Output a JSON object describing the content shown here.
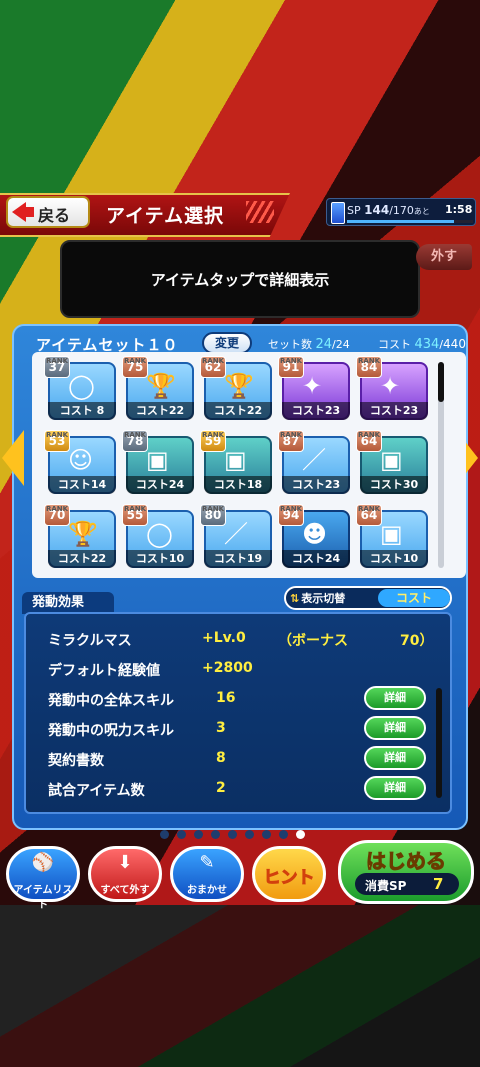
{
  "header": {
    "back_label": "戻る",
    "title": "アイテム選択",
    "sp_label": "SP",
    "sp_current": "144",
    "sp_max": "170",
    "sp_suffix": "あと",
    "timer": "1:58",
    "sp_fill_ratio": 0.847
  },
  "detail": {
    "hint": "アイテムタップで詳細表示",
    "remove_button": "外す"
  },
  "set": {
    "name": "アイテムセット１０",
    "change_button": "変更",
    "count_label": "セット数",
    "count_value": "24",
    "count_max": "24",
    "cost_label": "コスト",
    "cost_value": "434",
    "cost_max": "440"
  },
  "items": [
    {
      "rank_cap": "RANK",
      "rank": "37",
      "rank_color": "silver",
      "cost": "コスト 8",
      "art": "◯",
      "face": "blue"
    },
    {
      "rank_cap": "RANK",
      "rank": "75",
      "rank_color": "bronze",
      "cost": "コスト22",
      "art": "🏆",
      "face": "blue"
    },
    {
      "rank_cap": "RANK",
      "rank": "62",
      "rank_color": "bronze",
      "cost": "コスト22",
      "art": "🏆",
      "face": "blue"
    },
    {
      "rank_cap": "RANK",
      "rank": "91",
      "rank_color": "bronze",
      "cost": "コスト23",
      "art": "✦",
      "face": "purple"
    },
    {
      "rank_cap": "RANK",
      "rank": "84",
      "rank_color": "bronze",
      "cost": "コスト23",
      "art": "✦",
      "face": "purple"
    },
    {
      "rank_cap": "RANK",
      "rank": "53",
      "rank_color": "gold",
      "cost": "コスト14",
      "art": "☺",
      "face": "blue"
    },
    {
      "rank_cap": "RANK",
      "rank": "78",
      "rank_color": "silver",
      "cost": "コスト24",
      "art": "▣",
      "face": "teal"
    },
    {
      "rank_cap": "RANK",
      "rank": "59",
      "rank_color": "gold",
      "cost": "コスト18",
      "art": "▣",
      "face": "teal"
    },
    {
      "rank_cap": "RANK",
      "rank": "87",
      "rank_color": "bronze",
      "cost": "コスト23",
      "art": "／",
      "face": "blue"
    },
    {
      "rank_cap": "RANK",
      "rank": "64",
      "rank_color": "bronze",
      "cost": "コスト30",
      "art": "▣",
      "face": "teal"
    },
    {
      "rank_cap": "RANK",
      "rank": "70",
      "rank_color": "bronze",
      "cost": "コスト22",
      "art": "🏆",
      "face": "blue"
    },
    {
      "rank_cap": "RANK",
      "rank": "55",
      "rank_color": "bronze",
      "cost": "コスト10",
      "art": "◯",
      "face": "blue"
    },
    {
      "rank_cap": "RANK",
      "rank": "80",
      "rank_color": "silver",
      "cost": "コスト19",
      "art": "／",
      "face": "blue"
    },
    {
      "rank_cap": "RANK",
      "rank": "94",
      "rank_color": "bronze",
      "cost": "コスト24",
      "art": "☻",
      "face": "navy"
    },
    {
      "rank_cap": "RANK",
      "rank": "64",
      "rank_color": "bronze",
      "cost": "コスト10",
      "art": "▣",
      "face": "blue"
    }
  ],
  "effects": {
    "tab_label": "発動効果",
    "toggle_label": "表示切替",
    "toggle_value": "コスト",
    "rows": [
      {
        "label": "ミラクルマス",
        "value": "+Lv.0",
        "bonus_label": "（ボーナス",
        "bonus_value": "70）"
      },
      {
        "label": "デフォルト経験値",
        "value": "+2800"
      },
      {
        "label": "発動中の全体スキル",
        "value": "16",
        "button": "詳細"
      },
      {
        "label": "発動中の呪力スキル",
        "value": "3",
        "button": "詳細"
      },
      {
        "label": "契約書数",
        "value": "8",
        "button": "詳細"
      },
      {
        "label": "試合アイテム数",
        "value": "2",
        "button": "詳細"
      }
    ]
  },
  "pager": {
    "count": 9,
    "active": 8
  },
  "bottom": {
    "item_list": "アイテムリスト",
    "remove_all": "すべて外す",
    "auto": "おまかせ",
    "hint": "ヒント",
    "start": "はじめる",
    "sp_cost_label": "消費SP",
    "sp_cost_value": "7"
  },
  "colors": {
    "accent_yellow": "#ffee40",
    "panel_blue": "#1659b6",
    "header_red": "#b01414"
  }
}
